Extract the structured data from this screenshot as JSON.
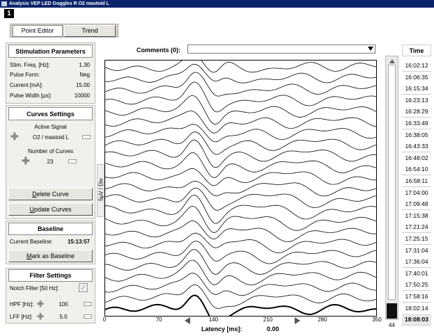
{
  "window": {
    "title": "Analysis VEP LED Goggles R O2 mastoid L",
    "page_number": "1"
  },
  "tabs": [
    {
      "label": "Point Editor",
      "active": true
    },
    {
      "label": "Trend",
      "active": false
    }
  ],
  "stimulation": {
    "header": "Stimulation Parameters",
    "rows": [
      {
        "label": "Stim. Freq. [Hz]:",
        "value": "1.30"
      },
      {
        "label": "Pulse Form:",
        "value": "Neg"
      },
      {
        "label": "Current [mA]:",
        "value": "15.00"
      },
      {
        "label": "Pulse Width [µs]:",
        "value": "10000"
      }
    ]
  },
  "curves": {
    "header": "Curves Settings",
    "active_signal_label": "Active Signal",
    "active_signal_value": "O2 / mastoid L",
    "num_curves_label": "Number of Curves",
    "num_curves_value": "23",
    "delete_button": "Delete Curve",
    "update_button": "Update Curves"
  },
  "baseline": {
    "header": "Baseline",
    "current_label": "Current Baseline:",
    "current_value": "15:13:57",
    "mark_button": "Mark as Baseline"
  },
  "filter": {
    "header": "Filter Settings",
    "notch_label": "Notch Filter [50 Hz]:",
    "notch_checked": true,
    "hpf_label": "HPF [Hz]:",
    "hpf_value": "100",
    "lpf_label": "LFF [Hz]:",
    "lpf_value": "5.0"
  },
  "comments": {
    "label": "Comments (0):",
    "value": ""
  },
  "chart_data": {
    "type": "line",
    "xlabel": "Latency [ms]:",
    "xlabel_value": "0.00",
    "ylabel": "5µV / Div",
    "xlim": [
      0,
      350
    ],
    "x_ticks": [
      "0",
      "70",
      "140",
      "210",
      "280",
      "350"
    ],
    "curve_count": 23
  },
  "scroll": {
    "count": "44"
  },
  "time_list": {
    "header": "Time",
    "items": [
      "16:02:12",
      "16:06:35",
      "16:15:34",
      "16:23:13",
      "16:28:29",
      "16:33:49",
      "16:38:05",
      "16:43:33",
      "16:48:02",
      "16:54:10",
      "16:58:11",
      "17:04:00",
      "17:09:48",
      "17:15:38",
      "17:21:24",
      "17:25:15",
      "17:31:04",
      "17:36:04",
      "17:40:01",
      "17:50:25",
      "17:58:16",
      "18:02:14",
      "18:08:03"
    ],
    "selected_index": 22
  },
  "colors": {
    "titlebar": "#0a246a",
    "panel_bg": "#f1f0ec",
    "trace": "#000000",
    "scroll_thumb": "#111111"
  }
}
